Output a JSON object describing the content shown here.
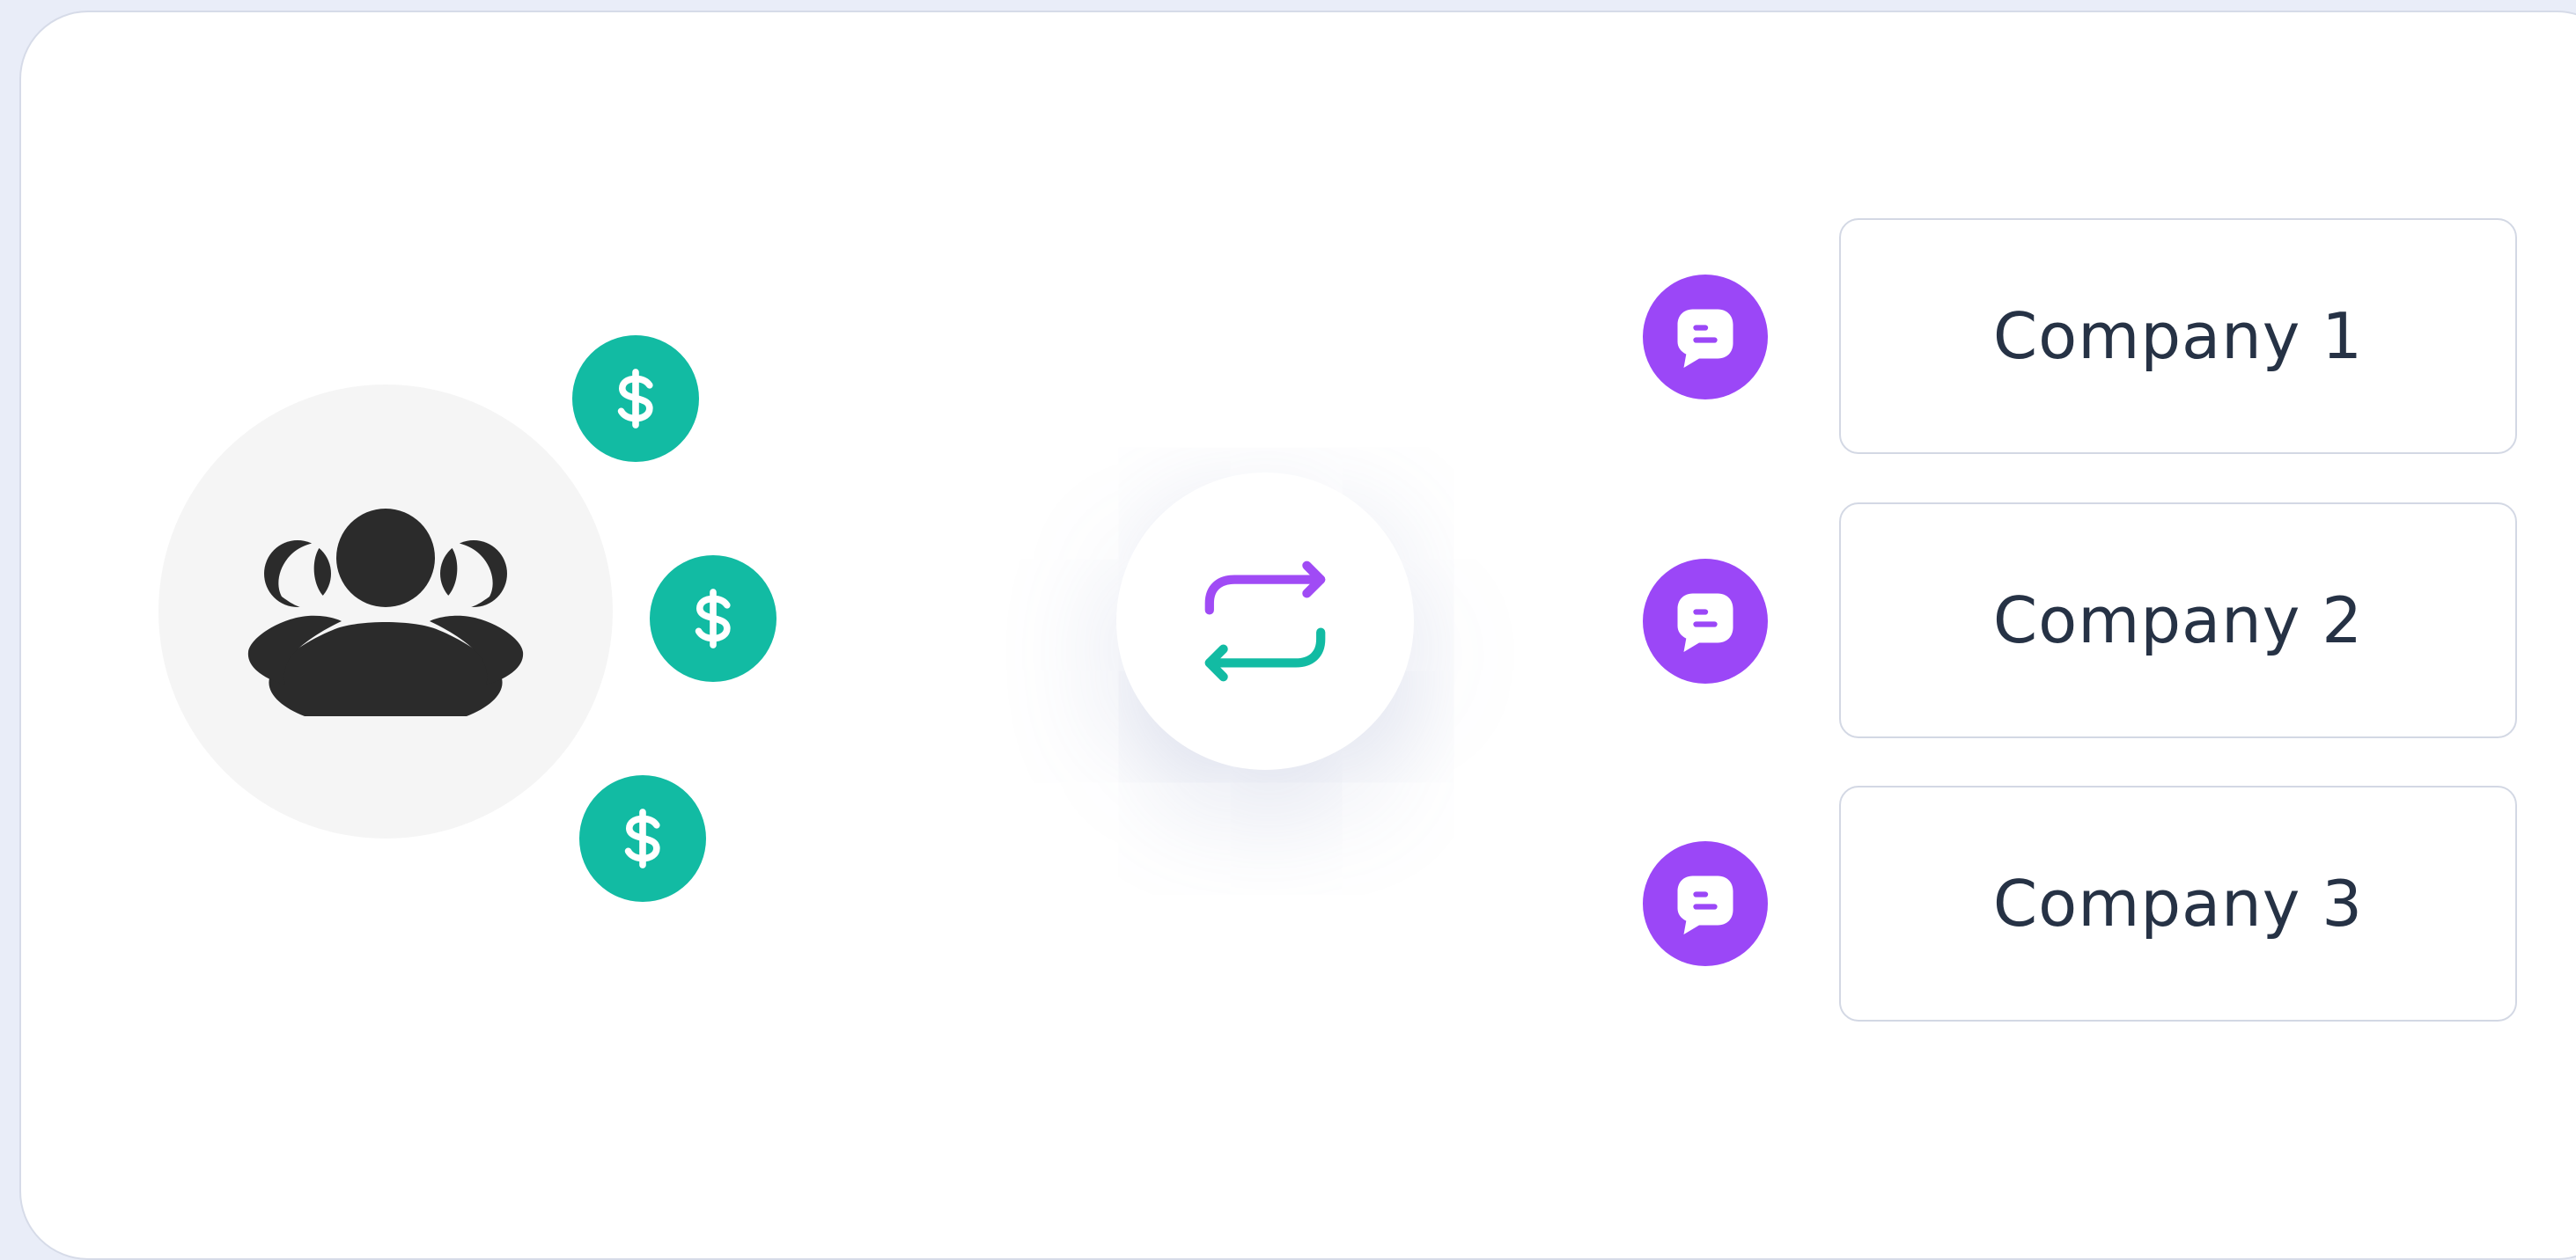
{
  "colors": {
    "background": "#e9edf8",
    "card": "#ffffff",
    "users_circle": "#f5f5f5",
    "users_icon": "#2b2b2b",
    "coin": "#12bba3",
    "hub_top_arrow": "#a04bf5",
    "hub_bottom_arrow": "#12bba3",
    "message_badge": "#9b47f7",
    "company_text": "#263245"
  },
  "icons": {
    "users": "users-group-icon",
    "coin": "dollar-icon",
    "hub": "repeat-arrows-icon",
    "message": "chat-bubble-icon"
  },
  "companies": [
    {
      "label": "Company 1"
    },
    {
      "label": "Company 2"
    },
    {
      "label": "Company 3"
    }
  ]
}
